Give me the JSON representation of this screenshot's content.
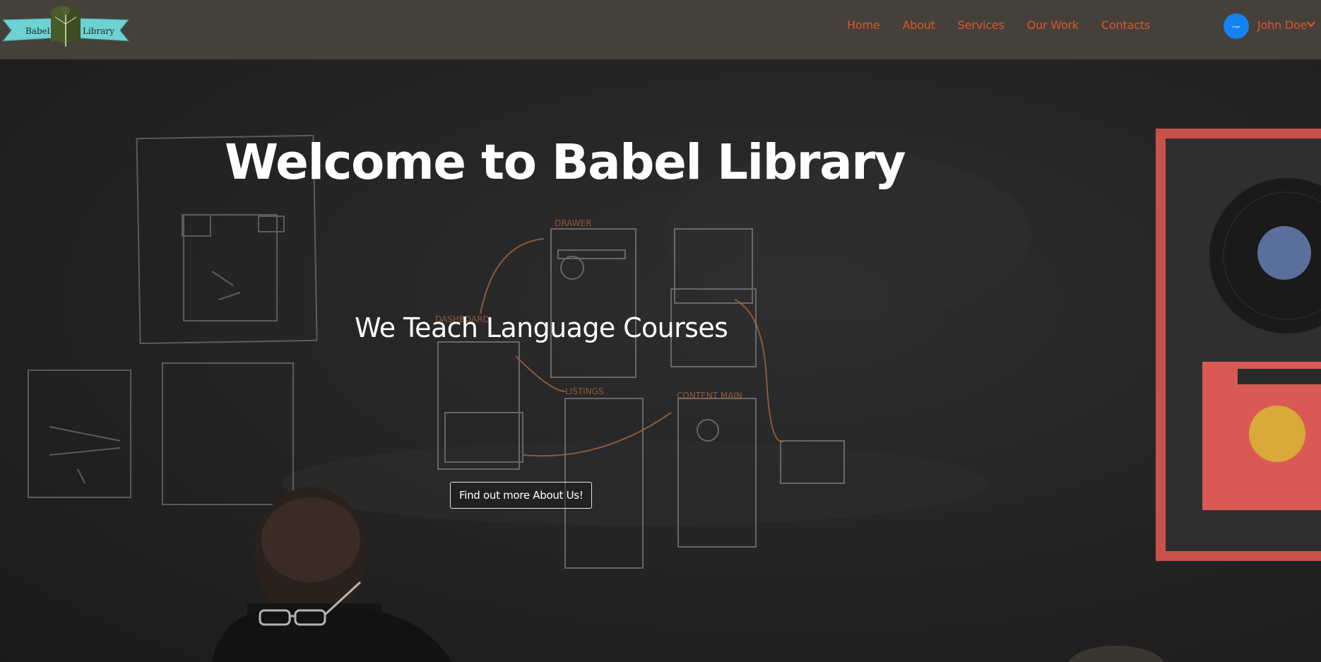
{
  "brand": {
    "logo_left_word": "Babel",
    "logo_right_word": "Library",
    "ribbon_color": "#6ed1d3"
  },
  "nav": {
    "links": [
      "Home",
      "About",
      "Services",
      "Our Work",
      "Contacts"
    ],
    "link_color": "#e0552d",
    "bar_color": "#45413a"
  },
  "user": {
    "name": "John Doe",
    "avatar_label": "image",
    "avatar_color": "#1482f0",
    "dropdown_icon": "chevron-down-icon"
  },
  "hero": {
    "title": "Welcome to Babel Library",
    "subtitle": "We Teach Language Courses",
    "cta_label": "Find out more About Us!"
  }
}
